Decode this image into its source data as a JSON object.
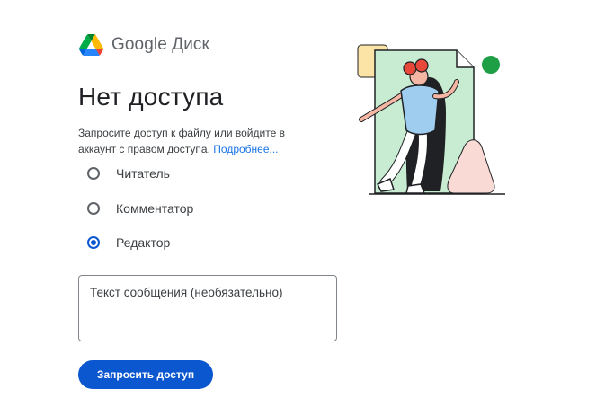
{
  "app": {
    "name": "Google Диск",
    "logo_icon": "google-drive-icon"
  },
  "main": {
    "title": "Нет доступа",
    "description": "Запросите доступ к файлу или войдите в аккаунт с правом доступа.",
    "learn_more": "Подробнее..."
  },
  "roles": [
    {
      "label": "Читатель",
      "checked": false
    },
    {
      "label": "Комментатор",
      "checked": false
    },
    {
      "label": "Редактор",
      "checked": true
    }
  ],
  "message": {
    "placeholder": "Текст сообщения (необязательно)",
    "value": ""
  },
  "actions": {
    "request_label": "Запросить доступ"
  },
  "colors": {
    "accent": "#0b57d0",
    "link": "#1a73e8",
    "illustration_green": "#c7ecd2",
    "dot_green": "#1e9e45",
    "illustration_pink": "#fadad4",
    "illustration_yellow": "#fbe4a6"
  }
}
